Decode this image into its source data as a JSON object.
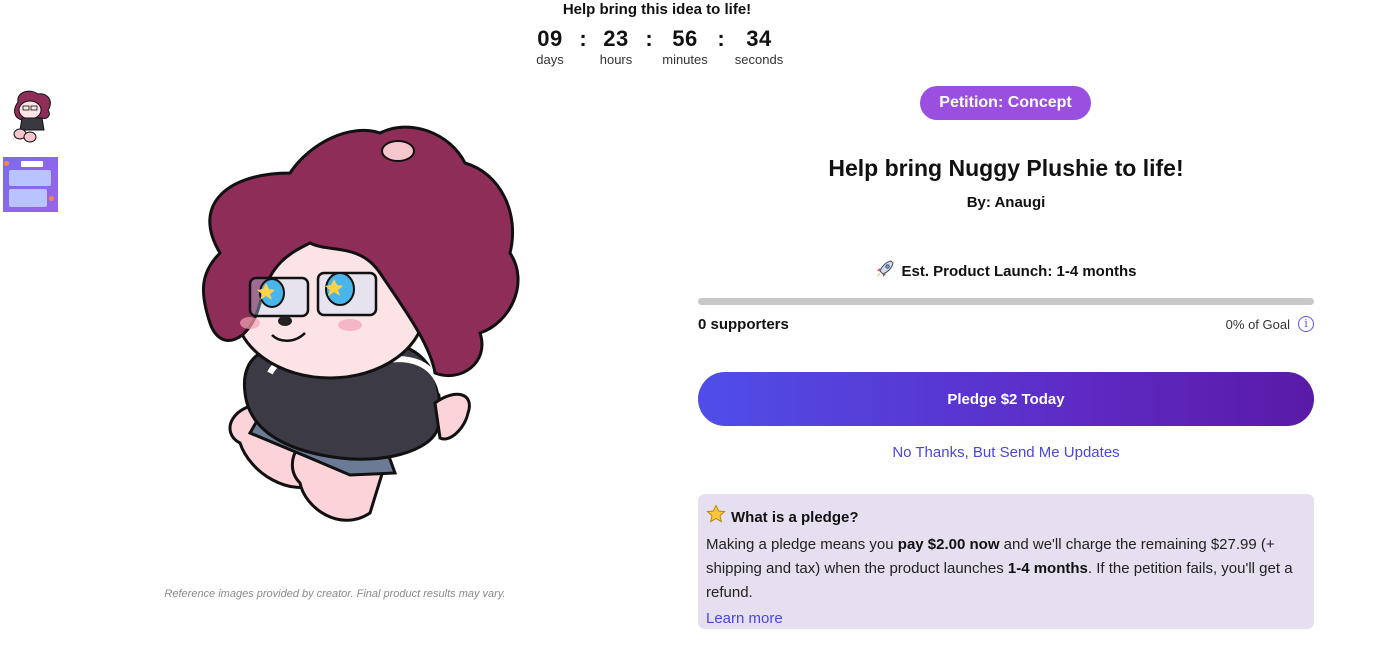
{
  "countdown": {
    "title": "Help bring this idea to life!",
    "units": [
      {
        "value": "09",
        "label": "days"
      },
      {
        "value": "23",
        "label": "hours"
      },
      {
        "value": "56",
        "label": "minutes"
      },
      {
        "value": "34",
        "label": "seconds"
      }
    ],
    "separator": ":"
  },
  "gallery": {
    "disclaimer": "Reference images provided by creator. Final product results may vary."
  },
  "product": {
    "badge": "Petition: Concept",
    "title": "Help bring Nuggy Plushie to life!",
    "byline": "By: Anaugi",
    "launch_icon": "rocket-icon",
    "launch_text": "Est. Product Launch: 1-4 months",
    "progress_fraction": 0,
    "supporters_count": "0",
    "supporters_label": "supporters",
    "goal_text": "0% of Goal",
    "pledge_button": "Pledge $2 Today",
    "no_thanks_link": "No Thanks, But Send Me Updates"
  },
  "pledge_info": {
    "icon": "star-icon",
    "heading": "What is a pledge?",
    "t1": "Making a pledge means you ",
    "b1": "pay $2.00 now",
    "t2": " and we'll charge the remaining $27.99 (+ shipping and tax) when the product launches ",
    "b2": "1-4 months",
    "t3": ". If the petition fails, you'll get a refund.",
    "learn_more": "Learn more"
  },
  "colors": {
    "badge": "#9b4fe0",
    "button_start": "#4f4ee8",
    "button_end": "#5a1aa6",
    "link": "#4a47d8",
    "info_bg": "#e6dff0"
  }
}
